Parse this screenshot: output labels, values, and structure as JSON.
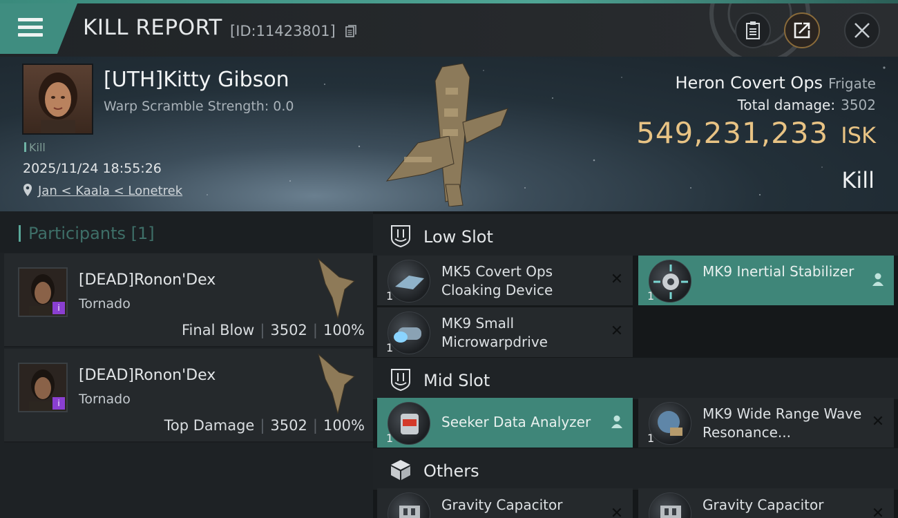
{
  "header": {
    "title": "KILL REPORT",
    "report_id": "[ID:11423801]"
  },
  "victim": {
    "name": "[UTH]Kitty Gibson",
    "scramble": "Warp Scramble Strength: 0.0",
    "kill_tag": "Kill",
    "timestamp": "2025/11/24 18:55:26",
    "location": "Jan < Kaala < Lonetrek",
    "ship": "Heron Covert Ops",
    "ship_class": "Frigate",
    "damage_label": "Total damage:",
    "damage": "3502",
    "isk_value": "549,231,233",
    "isk_unit": "ISK",
    "result": "Kill"
  },
  "participants": {
    "title": "Participants [1]",
    "items": [
      {
        "name": "[DEAD]Ronon'Dex",
        "ship": "Tornado",
        "role": "Final Blow",
        "damage": "3502",
        "percent": "100%"
      },
      {
        "name": "[DEAD]Ronon'Dex",
        "ship": "Tornado",
        "role": "Top Damage",
        "damage": "3502",
        "percent": "100%"
      }
    ]
  },
  "sections": {
    "low": "Low Slot",
    "mid": "Mid Slot",
    "others": "Others"
  },
  "modules": {
    "low": [
      {
        "name": "MK5 Covert Ops Cloaking Device",
        "qty": "1"
      },
      {
        "name": "MK9 Inertial Stabilizer",
        "qty": "1"
      },
      {
        "name": "MK9 Small Microwarpdrive",
        "qty": "1"
      }
    ],
    "mid": [
      {
        "name": "Seeker Data Analyzer",
        "qty": "1"
      },
      {
        "name": "MK9 Wide Range Wave Resonance...",
        "qty": "1"
      }
    ],
    "others": [
      {
        "name": "Gravity Capacitor"
      },
      {
        "name": "Gravity Capacitor"
      }
    ]
  },
  "colors": {
    "accent": "#3f8679",
    "isk": "#e8c384"
  }
}
